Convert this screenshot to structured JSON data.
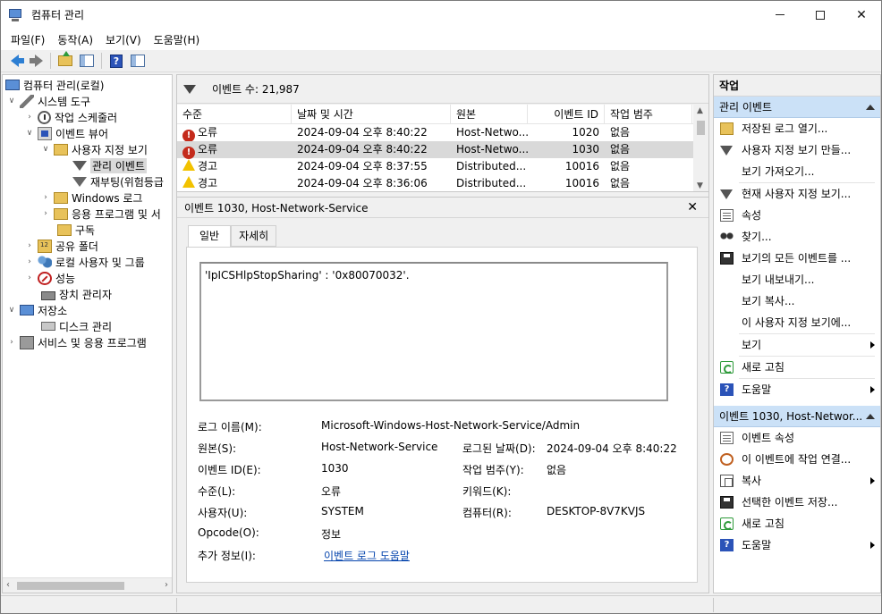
{
  "window": {
    "title": "컴퓨터 관리"
  },
  "menu": [
    "파일(F)",
    "동작(A)",
    "보기(V)",
    "도움말(H)"
  ],
  "tree": {
    "root": "컴퓨터 관리(로컬)",
    "system_tools": "시스템 도구",
    "task_scheduler": "작업 스케줄러",
    "event_viewer": "이벤트 뷰어",
    "custom_views": "사용자 지정 보기",
    "admin_events": "관리 이벤트",
    "reboot_hazard": "재부팅(위험등급",
    "windows_logs": "Windows 로그",
    "app_service_logs": "응용 프로그램 및 서",
    "subscriptions": "구독",
    "shared_folders": "공유 폴더",
    "local_users": "로컬 사용자 및 그룹",
    "performance": "성능",
    "device_manager": "장치 관리자",
    "storage": "저장소",
    "disk_management": "디스크 관리",
    "services_apps": "서비스 및 응용 프로그램"
  },
  "events": {
    "count_label": "이벤트 수: 21,987",
    "columns": [
      "수준",
      "날짜 및 시간",
      "원본",
      "이벤트 ID",
      "작업 범주"
    ],
    "rows": [
      {
        "level": "오류",
        "type": "error",
        "datetime": "2024-09-04 오후 8:40:22",
        "source": "Host-Netwo...",
        "id": "1020",
        "category": "없음"
      },
      {
        "level": "오류",
        "type": "error",
        "datetime": "2024-09-04 오후 8:40:22",
        "source": "Host-Netwo...",
        "id": "1030",
        "category": "없음"
      },
      {
        "level": "경고",
        "type": "warning",
        "datetime": "2024-09-04 오후 8:37:55",
        "source": "Distributed...",
        "id": "10016",
        "category": "없음"
      },
      {
        "level": "경고",
        "type": "warning",
        "datetime": "2024-09-04 오후 8:36:06",
        "source": "Distributed...",
        "id": "10016",
        "category": "없음"
      }
    ]
  },
  "detail": {
    "title": "이벤트 1030, Host-Network-Service",
    "tab_general": "일반",
    "tab_details": "자세히",
    "description": "'IpICSHlpStopSharing' : '0x80070032'.",
    "log_name_label": "로그 이름(M):",
    "log_name": "Microsoft-Windows-Host-Network-Service/Admin",
    "source_label": "원본(S):",
    "source": "Host-Network-Service",
    "logged_label": "로그된 날짜(D):",
    "logged": "2024-09-04 오후 8:40:22",
    "event_id_label": "이벤트 ID(E):",
    "event_id": "1030",
    "task_cat_label": "작업 범주(Y):",
    "task_cat": "없음",
    "level_label": "수준(L):",
    "level": "오류",
    "keywords_label": "키워드(K):",
    "keywords": "",
    "user_label": "사용자(U):",
    "user": "SYSTEM",
    "computer_label": "컴퓨터(R):",
    "computer": "DESKTOP-8V7KVJS",
    "opcode_label": "Opcode(O):",
    "opcode": "정보",
    "more_info_label": "추가 정보(I):",
    "more_info_link": "이벤트 로그 도움말"
  },
  "actions": {
    "title": "작업",
    "section1": "관리 이벤트",
    "items1": [
      "저장된 로그 열기...",
      "사용자 지정 보기 만들...",
      "보기 가져오기...",
      "현재 사용자 지정 보기...",
      "속성",
      "찾기...",
      "보기의 모든 이벤트를 ...",
      "보기 내보내기...",
      "보기 복사...",
      "이 사용자 지정 보기에...",
      "보기",
      "새로 고침",
      "도움말"
    ],
    "section2": "이벤트 1030, Host-Networ...",
    "items2": [
      "이벤트 속성",
      "이 이벤트에 작업 연결...",
      "복사",
      "선택한 이벤트 저장...",
      "새로 고침",
      "도움말"
    ]
  }
}
